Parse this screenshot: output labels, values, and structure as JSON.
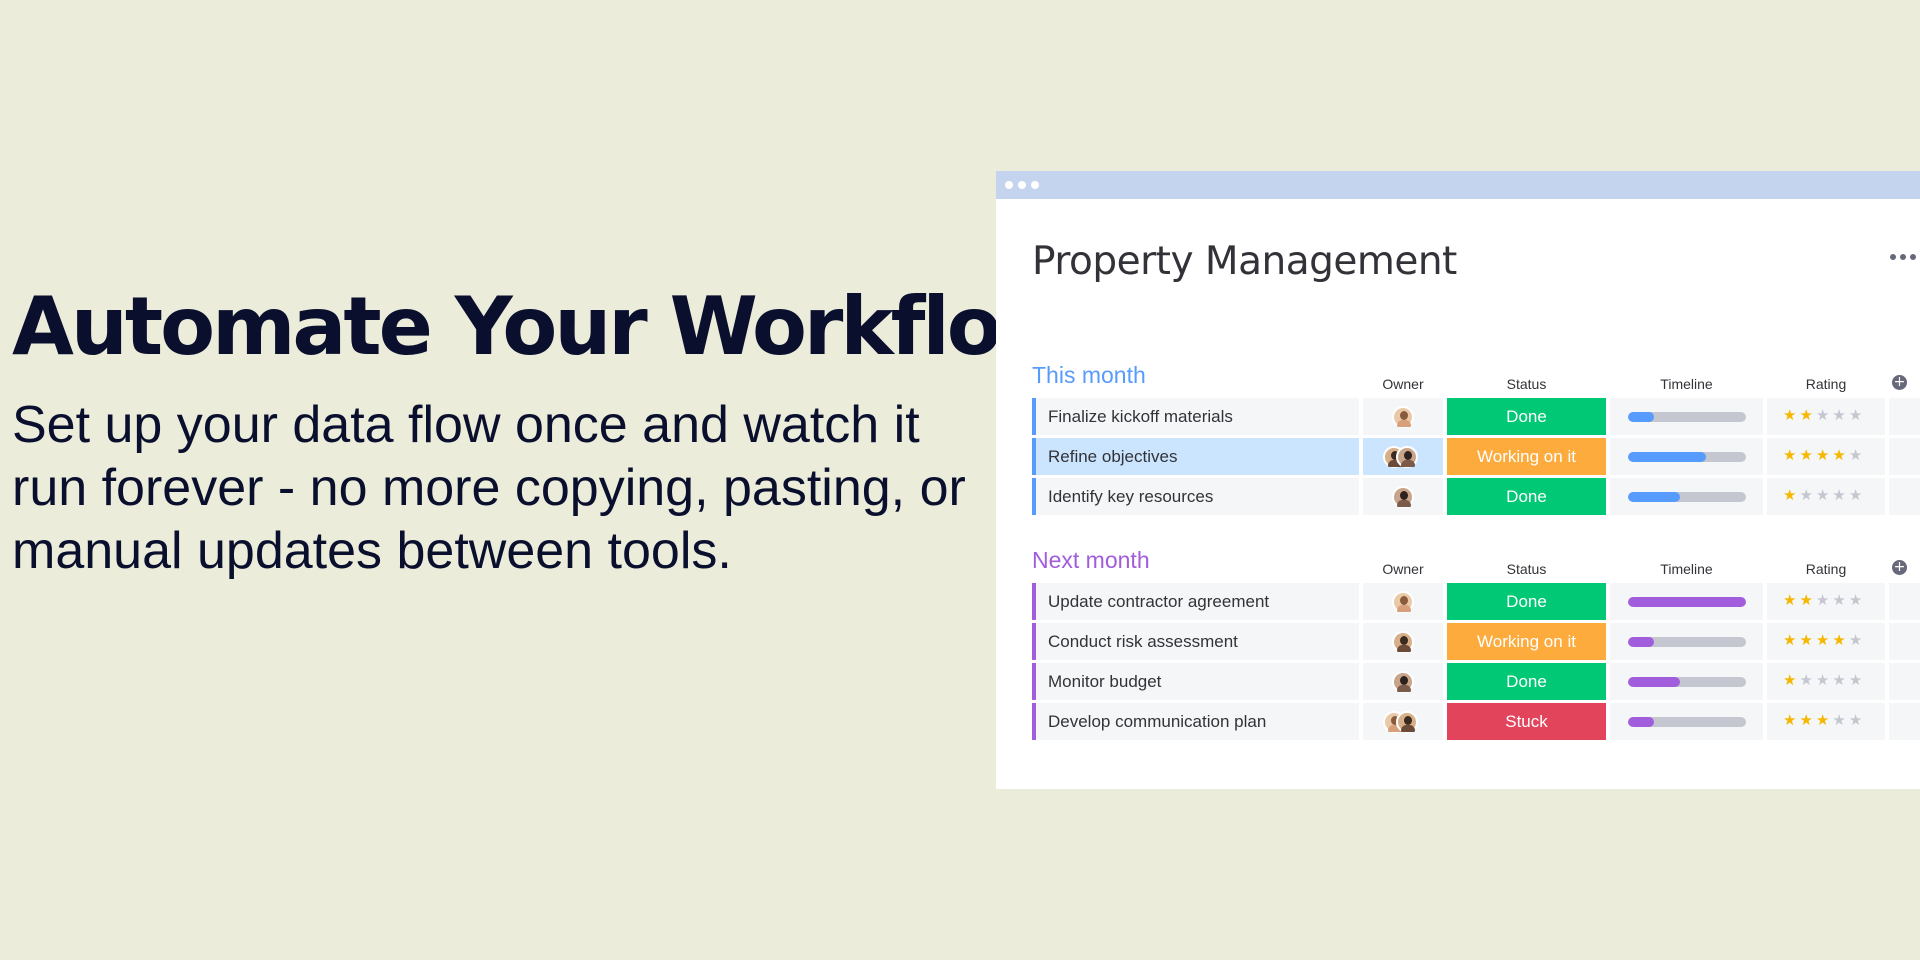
{
  "hero": {
    "title": "Automate Your Workflow",
    "subtitle": "Set up your data flow once and watch it run forever - no more copying, pasting, or manual updates between tools."
  },
  "board": {
    "title": "Property Management",
    "more_icon": "more-horizontal-icon",
    "columns": {
      "owner": "Owner",
      "status": "Status",
      "timeline": "Timeline",
      "rating": "Rating"
    },
    "groups": [
      {
        "title": "This month",
        "color": "#579bfc",
        "rows": [
          {
            "name": "Finalize kickoff materials",
            "owners": 1,
            "status": "Done",
            "status_color": "#00c875",
            "timeline": 0.22,
            "rating": 2,
            "selected": false
          },
          {
            "name": "Refine objectives",
            "owners": 2,
            "status": "Working on it",
            "status_color": "#fdab3d",
            "timeline": 0.66,
            "rating": 4,
            "selected": true
          },
          {
            "name": "Identify key resources",
            "owners": 1,
            "status": "Done",
            "status_color": "#00c875",
            "timeline": 0.44,
            "rating": 1,
            "selected": false
          }
        ]
      },
      {
        "title": "Next month",
        "color": "#a25ddc",
        "rows": [
          {
            "name": "Update contractor agreement",
            "owners": 1,
            "status": "Done",
            "status_color": "#00c875",
            "timeline": 1.0,
            "rating": 2,
            "selected": false
          },
          {
            "name": "Conduct risk assessment",
            "owners": 1,
            "status": "Working on it",
            "status_color": "#fdab3d",
            "timeline": 0.22,
            "rating": 4,
            "selected": false
          },
          {
            "name": "Monitor budget",
            "owners": 1,
            "status": "Done",
            "status_color": "#00c875",
            "timeline": 0.44,
            "rating": 1,
            "selected": false
          },
          {
            "name": "Develop communication plan",
            "owners": 2,
            "status": "Stuck",
            "status_color": "#e2445c",
            "timeline": 0.22,
            "rating": 3,
            "selected": false
          }
        ]
      }
    ],
    "rating_max": 5,
    "add_column_icon": "plus-circle-icon"
  }
}
